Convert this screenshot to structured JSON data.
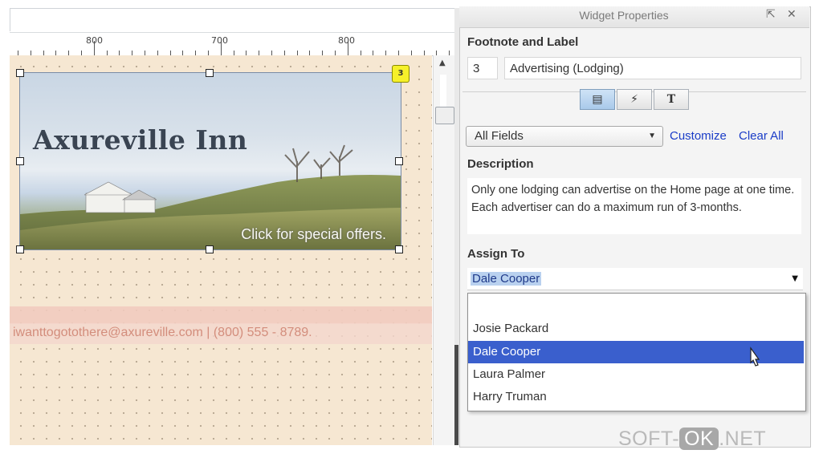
{
  "ruler": {
    "labels": [
      "800",
      "700",
      "800"
    ]
  },
  "canvas": {
    "banner_title": "Axureville Inn",
    "banner_cta": "Click for special offers.",
    "footnote_badge": "3",
    "contact_text": "iwanttogotothere@axureville.com | (800) 555 - 8789."
  },
  "panel": {
    "title": "Widget Properties",
    "footnote_label_heading": "Footnote and Label",
    "footnote_number": "3",
    "label_value": "Advertising (Lodging)",
    "tabs": [
      "annotation-icon",
      "interactions-icon",
      "text-format-icon"
    ],
    "fields_select": "All Fields",
    "customize_link": "Customize",
    "clear_all_link": "Clear All",
    "description_heading": "Description",
    "description_text": "Only one lodging can advertise on the Home page at one time. Each advertiser can do a maximum run of 3-months.",
    "assign_heading": "Assign To",
    "assign_value": "Dale Cooper",
    "options": [
      "",
      "Josie Packard",
      "Dale Cooper",
      "Laura Palmer",
      "Harry Truman"
    ],
    "selected_option": "Dale Cooper"
  },
  "watermark": {
    "left": "SOFT-",
    "ok": "OK",
    "right": ".NET"
  },
  "colors": {
    "selection": "#3a5fcd",
    "link": "#1a3cc7",
    "canvas_bg": "#f6e7d2",
    "badge": "#f6f12a"
  }
}
